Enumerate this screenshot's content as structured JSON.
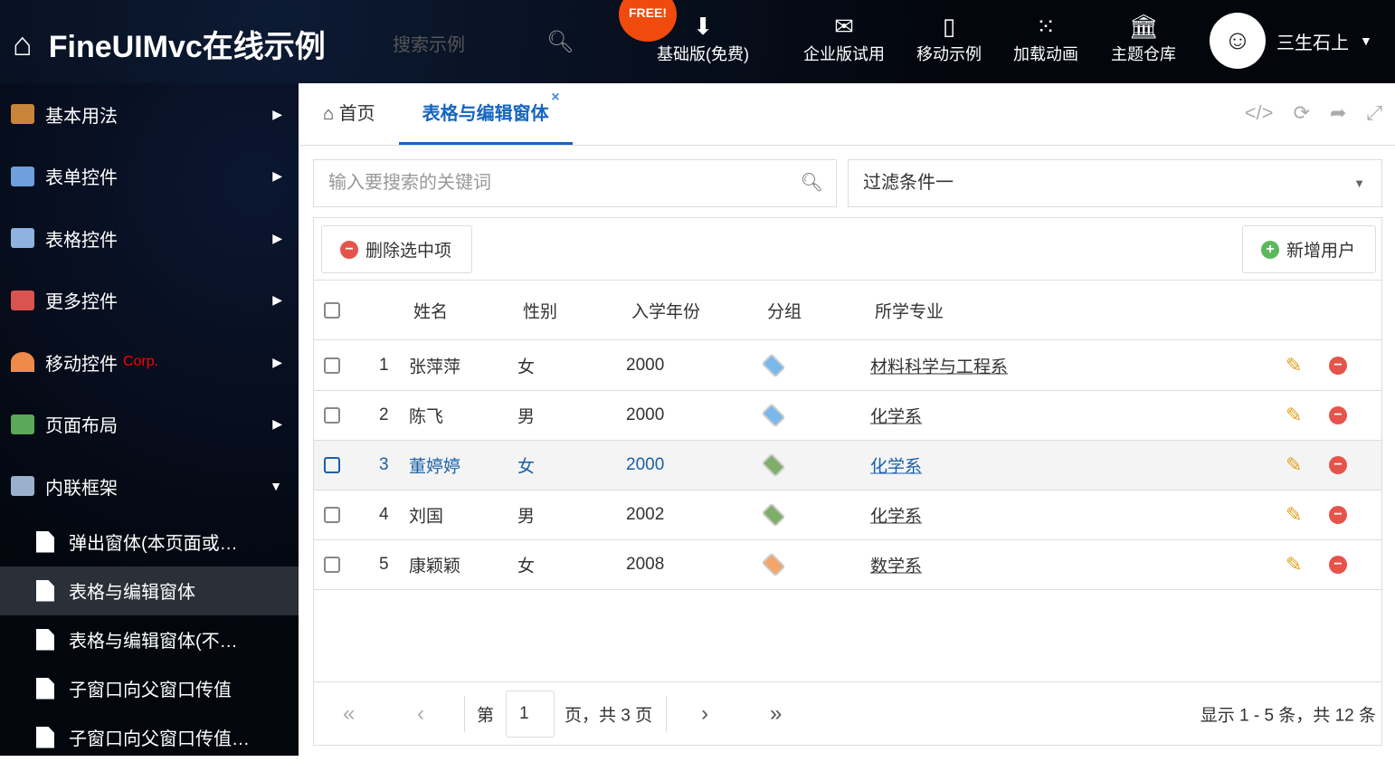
{
  "header": {
    "title": "FineUIMvc在线示例",
    "search_placeholder": "搜索示例",
    "free_badge": "FREE!",
    "nav": [
      {
        "label": "基础版(免费)",
        "icon": "download-icon"
      },
      {
        "label": "企业版试用",
        "icon": "envelope-icon"
      },
      {
        "label": "移动示例",
        "icon": "mobile-icon"
      },
      {
        "label": "加载动画",
        "icon": "spinner-icon"
      },
      {
        "label": "主题仓库",
        "icon": "bank-icon"
      }
    ],
    "user": "三生石上"
  },
  "sidebar": {
    "items": [
      {
        "label": "基本用法",
        "color": "#c8843a"
      },
      {
        "label": "表单控件",
        "color": "#6f9fdc"
      },
      {
        "label": "表格控件",
        "color": "#8fb2e0"
      },
      {
        "label": "更多控件",
        "color": "#d9534f"
      },
      {
        "label": "移动控件",
        "badge": "Corp.",
        "color": "#f08a4b"
      },
      {
        "label": "页面布局",
        "color": "#5aa85a"
      },
      {
        "label": "内联框架",
        "color": "#9ab0cc"
      }
    ],
    "subitems": [
      "弹出窗体(本页面或…",
      "表格与编辑窗体",
      "表格与编辑窗体(不…",
      "子窗口向父窗口传值",
      "子窗口向父窗口传值…"
    ]
  },
  "tabs": [
    {
      "label": "首页"
    },
    {
      "label": "表格与编辑窗体",
      "close": "×"
    }
  ],
  "toolbar": {
    "search_placeholder": "输入要搜索的关键词",
    "filter": "过滤条件一",
    "delete": "删除选中项",
    "add": "新增用户"
  },
  "grid": {
    "columns": [
      "姓名",
      "性别",
      "入学年份",
      "分组",
      "所学专业"
    ],
    "rows": [
      {
        "n": "1",
        "name": "张萍萍",
        "gender": "女",
        "year": "2000",
        "tag": "#7ab8ec",
        "major": "材料科学与工程系"
      },
      {
        "n": "2",
        "name": "陈飞",
        "gender": "男",
        "year": "2000",
        "tag": "#7ab8ec",
        "major": "化学系"
      },
      {
        "n": "3",
        "name": "董婷婷",
        "gender": "女",
        "year": "2000",
        "tag": "#7fae6a",
        "major": "化学系"
      },
      {
        "n": "4",
        "name": "刘国",
        "gender": "男",
        "year": "2002",
        "tag": "#7fae6a",
        "major": "化学系"
      },
      {
        "n": "5",
        "name": "康颖颖",
        "gender": "女",
        "year": "2008",
        "tag": "#f4a56a",
        "major": "数学系"
      }
    ]
  },
  "pager": {
    "prefix": "第",
    "page": "1",
    "suffix": "页，共 3 页",
    "summary": "显示 1 - 5 条，共 12 条"
  }
}
